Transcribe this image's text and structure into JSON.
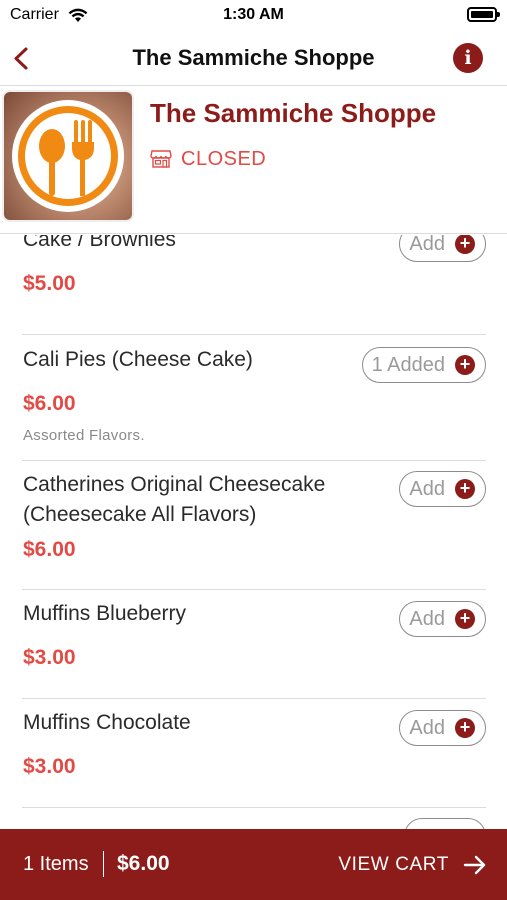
{
  "status_bar": {
    "carrier": "Carrier",
    "time": "1:30 AM"
  },
  "nav": {
    "title": "The Sammiche Shoppe",
    "back_icon": "chevron-left-icon",
    "info_icon": "info-icon",
    "info_glyph": "i"
  },
  "store": {
    "name": "The Sammiche Shoppe",
    "status": "CLOSED",
    "status_icon": "storefront-icon",
    "logo": "spoon-fork-logo"
  },
  "menu": {
    "items": [
      {
        "name": "Cake / Brownies",
        "price": "$5.00",
        "button": "Add"
      },
      {
        "name": "Cali Pies (Cheese Cake)",
        "price": "$6.00",
        "description": "Assorted Flavors.",
        "button": "1 Added"
      },
      {
        "name": "Catherines Original Cheesecake",
        "name_line2": "(Cheesecake All Flavors)",
        "price": "$6.00",
        "button": "Add"
      },
      {
        "name": "Muffins Blueberry",
        "price": "$3.00",
        "button": "Add"
      },
      {
        "name": "Muffins Chocolate",
        "price": "$3.00",
        "button": "Add"
      }
    ],
    "plus_glyph": "+"
  },
  "cart": {
    "count_label": "1 Items",
    "total": "$6.00",
    "view_label": "VIEW CART",
    "arrow_icon": "arrow-right-icon"
  },
  "colors": {
    "brand": "#8c1c1a",
    "price": "#e24a45",
    "muted": "#9a9a9a"
  }
}
